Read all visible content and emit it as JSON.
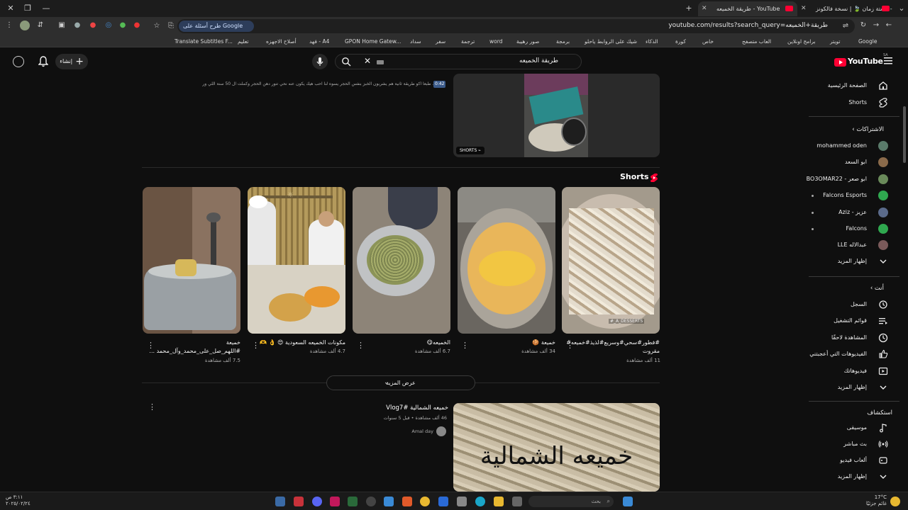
{
  "browser": {
    "tabs": [
      {
        "label": "طريقة الخميعه - YouTube",
        "active": true
      },
      {
        "label": "كشتة زمان 🍃 | نسخة فالكونز - ..."
      }
    ],
    "url": "youtube.com/results?search_query=طريقة+الخميعه",
    "google_pill": "طرح أسئلة على Google",
    "bookmarks": [
      "Google",
      "تويتر",
      "برامج اونلاين",
      "العاب متصفح",
      "خاص",
      "كورة",
      "الذكاء",
      "شيك على الروابط ياحلو",
      "برمجة",
      "صور رهيبة",
      "word",
      "ترجمة",
      "سفر",
      "سداد",
      "GPON Home Gatew...",
      "فهد - A4",
      "أصلاح الاجهزه",
      "تعليم",
      "Translate Subtitles F..."
    ]
  },
  "header": {
    "logo": "YouTube",
    "logo_region": "SA",
    "search_value": "طريقة الخميعه",
    "create_label": "إنشاء"
  },
  "sidebar": {
    "main": [
      {
        "label": "الصفحة الرئيسية",
        "icon": "home-icon"
      },
      {
        "label": "Shorts",
        "icon": "shorts-icon"
      }
    ],
    "subscriptions_title": "الاشتراكات",
    "subscriptions": [
      {
        "label": "mohammed oden",
        "color": "#5a7a6a",
        "dot": false
      },
      {
        "label": "ابو السعد",
        "color": "#8a6a4a",
        "dot": false
      },
      {
        "label": "ابو صعر - BO3OMAR22",
        "color": "#6a8a5a",
        "dot": false
      },
      {
        "label": "Falcons Esports",
        "color": "#2fa84f",
        "dot": true
      },
      {
        "label": "عزيز - Aziz",
        "color": "#5a6a8a",
        "dot": true
      },
      {
        "label": "Falcons",
        "color": "#2fa84f",
        "dot": true
      },
      {
        "label": "عبدالاله LLE",
        "color": "#7a5a5a",
        "dot": false
      }
    ],
    "show_more": "إظهار المزيد",
    "you_title": "أنت",
    "you_items": [
      {
        "label": "السجل",
        "icon": "history-icon"
      },
      {
        "label": "قوائم التشغيل",
        "icon": "playlist-icon"
      },
      {
        "label": "المشاهدة لاحقًا",
        "icon": "watch-later-icon"
      },
      {
        "label": "الفيديوهات التي أعجبتني",
        "icon": "like-icon"
      },
      {
        "label": "فيديوهاتك",
        "icon": "your-videos-icon"
      }
    ],
    "show_more_2": "إظهار المزيد",
    "explore_title": "استكشاف",
    "explore_items": [
      {
        "label": "موسيقى",
        "icon": "music-icon"
      },
      {
        "label": "بث مباشر",
        "icon": "live-icon"
      },
      {
        "label": "ألعاب فيديو",
        "icon": "gaming-icon"
      }
    ],
    "show_more_3": "إظهار المزيد"
  },
  "content": {
    "top_description": "... طبعا اكو طريقة ثانية هم يشربون الخبز بنفس الحجر يسوه لنا احب هيك يكون عنه نحي تنور دهن الحجر وكملت ال 50 سنة اللي ورا حلوين عافيه.",
    "top_duration": "0:42",
    "shorts_badge": "SHORTS",
    "shorts_title": "Shorts",
    "shorts": [
      {
        "title": "#فطور#سحي#وسريع#لذيذ#خميعه# مقروت",
        "views": "11 ألف مشاهدة",
        "watermark": "#_A_DESSERTS"
      },
      {
        "title": "خميعة 🍪",
        "views": "34 ألف مشاهدة"
      },
      {
        "title": "الخميعه😋",
        "views": "6.7 ألف مشاهدة"
      },
      {
        "title": "مكونات الخميعه السعودية 😍 👌 🫶",
        "views": "4.7 ألف مشاهدة"
      },
      {
        "title": "خميعة #اللهم_صل_على_محمد_وآل_محمد ...",
        "views": "7.5 ألف مشاهدة"
      }
    ],
    "show_more_label": "عرض المزيد",
    "video2": {
      "title": "خميعه الشمالية #Vlog7",
      "meta": "46 ألف مشاهدة • قبل 5 سنوات",
      "channel": "Amal day",
      "thumb_text": "خميعه الشمالية"
    }
  },
  "taskbar": {
    "search_placeholder": "بحث",
    "weather_temp": "17°C",
    "weather_desc": "غائم جزئيًا",
    "time": "٣:١١ ص",
    "date": "٢٠٢٥/٠٢/٢٤"
  }
}
